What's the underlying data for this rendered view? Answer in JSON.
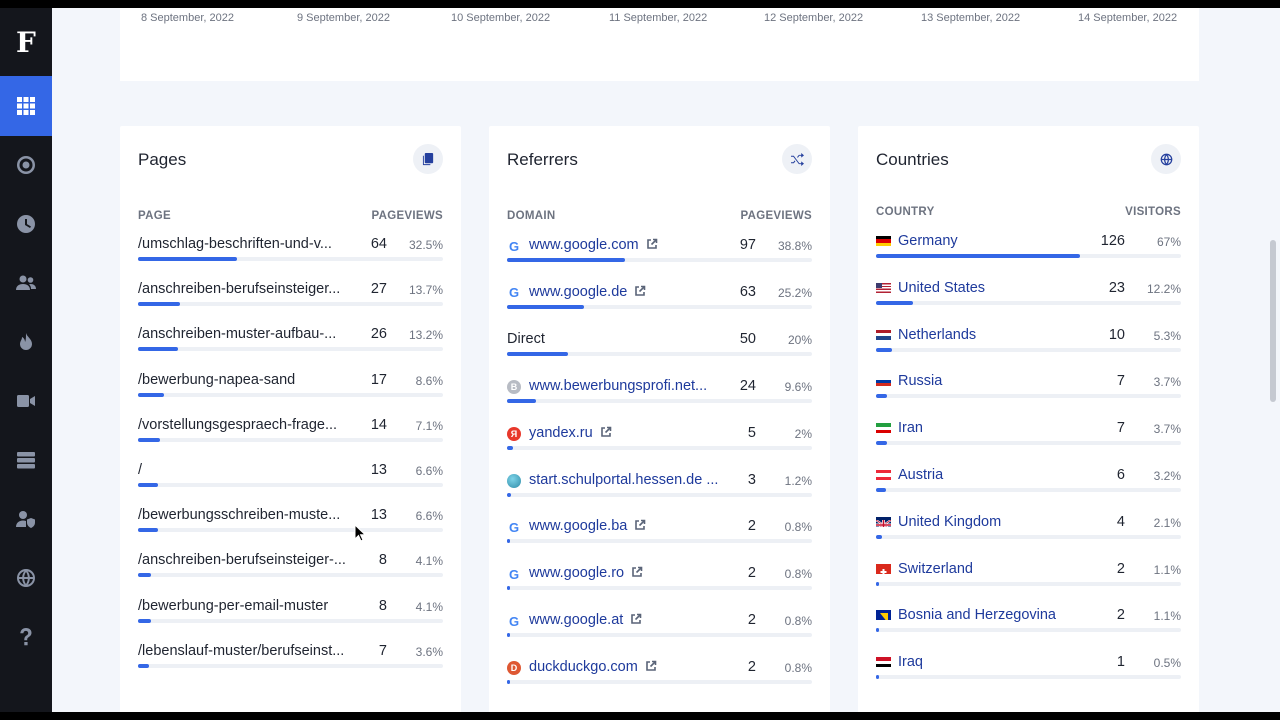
{
  "sidebar": {
    "logo": "F",
    "items": [
      {
        "name": "dashboard-icon",
        "active": true
      },
      {
        "name": "target-icon",
        "active": false
      },
      {
        "name": "clock-icon",
        "active": false
      },
      {
        "name": "users-icon",
        "active": false
      },
      {
        "name": "flame-icon",
        "active": false
      },
      {
        "name": "video-icon",
        "active": false
      },
      {
        "name": "server-icon",
        "active": false
      },
      {
        "name": "user-shield-icon",
        "active": false
      },
      {
        "name": "globe-icon",
        "active": false
      },
      {
        "name": "help-icon",
        "active": false
      }
    ]
  },
  "chart_dates": [
    "8 September, 2022",
    "9 September, 2022",
    "10 September, 2022",
    "11 September, 2022",
    "12 September, 2022",
    "13 September, 2022",
    "14 September, 2022"
  ],
  "pages": {
    "title": "Pages",
    "icon": "copy-icon",
    "col_label": "PAGE",
    "col_value": "PAGEVIEWS",
    "rows": [
      {
        "label": "/umschlag-beschriften-und-v...",
        "value": "64",
        "pct": "32.5%",
        "fill": 0.325
      },
      {
        "label": "/anschreiben-berufseinsteiger...",
        "value": "27",
        "pct": "13.7%",
        "fill": 0.137
      },
      {
        "label": "/anschreiben-muster-aufbau-...",
        "value": "26",
        "pct": "13.2%",
        "fill": 0.132
      },
      {
        "label": "/bewerbung-napea-sand",
        "value": "17",
        "pct": "8.6%",
        "fill": 0.086
      },
      {
        "label": "/vorstellungsgespraech-frage...",
        "value": "14",
        "pct": "7.1%",
        "fill": 0.071
      },
      {
        "label": "/",
        "value": "13",
        "pct": "6.6%",
        "fill": 0.066
      },
      {
        "label": "/bewerbungsschreiben-muste...",
        "value": "13",
        "pct": "6.6%",
        "fill": 0.066
      },
      {
        "label": "/anschreiben-berufseinsteiger-...",
        "value": "8",
        "pct": "4.1%",
        "fill": 0.041
      },
      {
        "label": "/bewerbung-per-email-muster",
        "value": "8",
        "pct": "4.1%",
        "fill": 0.041
      },
      {
        "label": "/lebenslauf-muster/berufseinst...",
        "value": "7",
        "pct": "3.6%",
        "fill": 0.036
      }
    ]
  },
  "referrers": {
    "title": "Referrers",
    "icon": "shuffle-icon",
    "col_label": "DOMAIN",
    "col_value": "PAGEVIEWS",
    "rows": [
      {
        "label": "www.google.com",
        "value": "97",
        "pct": "38.8%",
        "fill": 0.388,
        "favicon": "google",
        "ext": true
      },
      {
        "label": "www.google.de",
        "value": "63",
        "pct": "25.2%",
        "fill": 0.252,
        "favicon": "google",
        "ext": true
      },
      {
        "label": "Direct",
        "value": "50",
        "pct": "20%",
        "fill": 0.2,
        "favicon": "none",
        "ext": false
      },
      {
        "label": "www.bewerbungsprofi.net...",
        "value": "24",
        "pct": "9.6%",
        "fill": 0.096,
        "favicon": "b",
        "ext": false
      },
      {
        "label": "yandex.ru",
        "value": "5",
        "pct": "2%",
        "fill": 0.02,
        "favicon": "yandex",
        "ext": true
      },
      {
        "label": "start.schulportal.hessen.de ...",
        "value": "3",
        "pct": "1.2%",
        "fill": 0.012,
        "favicon": "globe",
        "ext": false
      },
      {
        "label": "www.google.ba",
        "value": "2",
        "pct": "0.8%",
        "fill": 0.008,
        "favicon": "google",
        "ext": true
      },
      {
        "label": "www.google.ro",
        "value": "2",
        "pct": "0.8%",
        "fill": 0.008,
        "favicon": "google",
        "ext": true
      },
      {
        "label": "www.google.at",
        "value": "2",
        "pct": "0.8%",
        "fill": 0.008,
        "favicon": "google",
        "ext": true
      },
      {
        "label": "duckduckgo.com",
        "value": "2",
        "pct": "0.8%",
        "fill": 0.008,
        "favicon": "duck",
        "ext": true
      }
    ]
  },
  "countries": {
    "title": "Countries",
    "icon": "globe-icon",
    "col_label": "COUNTRY",
    "col_value": "VISITORS",
    "rows": [
      {
        "label": "Germany",
        "value": "126",
        "pct": "67%",
        "fill": 0.67,
        "flag": "de"
      },
      {
        "label": "United States",
        "value": "23",
        "pct": "12.2%",
        "fill": 0.122,
        "flag": "us"
      },
      {
        "label": "Netherlands",
        "value": "10",
        "pct": "5.3%",
        "fill": 0.053,
        "flag": "nl"
      },
      {
        "label": "Russia",
        "value": "7",
        "pct": "3.7%",
        "fill": 0.037,
        "flag": "ru"
      },
      {
        "label": "Iran",
        "value": "7",
        "pct": "3.7%",
        "fill": 0.037,
        "flag": "ir"
      },
      {
        "label": "Austria",
        "value": "6",
        "pct": "3.2%",
        "fill": 0.032,
        "flag": "at"
      },
      {
        "label": "United Kingdom",
        "value": "4",
        "pct": "2.1%",
        "fill": 0.021,
        "flag": "gb"
      },
      {
        "label": "Switzerland",
        "value": "2",
        "pct": "1.1%",
        "fill": 0.011,
        "flag": "ch"
      },
      {
        "label": "Bosnia and Herzegovina",
        "value": "2",
        "pct": "1.1%",
        "fill": 0.011,
        "flag": "ba"
      },
      {
        "label": "Iraq",
        "value": "1",
        "pct": "0.5%",
        "fill": 0.005,
        "flag": "iq"
      }
    ]
  },
  "colors": {
    "accent": "#3467e6",
    "sidebar": "#14161c",
    "link": "#1e3a9c"
  }
}
